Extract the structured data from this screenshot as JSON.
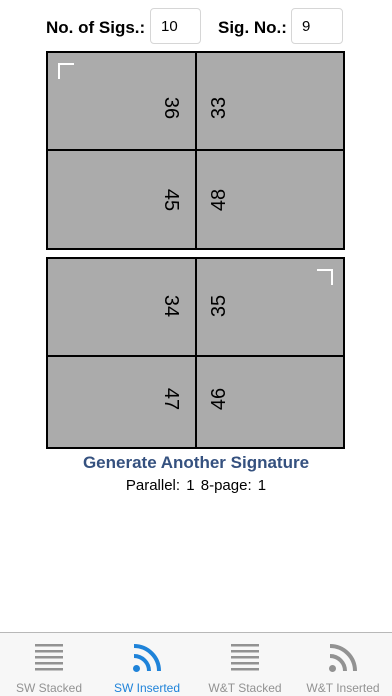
{
  "header": {
    "num_sigs_label": "No. of Sigs.:",
    "num_sigs_value": "10",
    "sig_no_label": "Sig. No.:",
    "sig_no_value": "9"
  },
  "sheets": [
    {
      "pages": {
        "top_left": "36",
        "top_right": "33",
        "bottom_left": "45",
        "bottom_right": "48"
      }
    },
    {
      "pages": {
        "top_left": "34",
        "top_right": "35",
        "bottom_left": "47",
        "bottom_right": "46"
      }
    }
  ],
  "generate_label": "Generate Another Signature",
  "info": {
    "parallel": "Parallel: 1",
    "eight_page": "8-page: 1"
  },
  "tabs": [
    {
      "label": "SW Stacked",
      "icon": "stack-lines-icon",
      "active": false
    },
    {
      "label": "SW Inserted",
      "icon": "broadcast-icon",
      "active": true
    },
    {
      "label": "W&T Stacked",
      "icon": "stack-lines-icon",
      "active": false
    },
    {
      "label": "W&T Inserted",
      "icon": "broadcast-icon",
      "active": false
    }
  ],
  "colors": {
    "sheet": "#ababab",
    "accent": "#1f83d9",
    "generate_text": "#35517f",
    "inactive_tab": "#929292"
  }
}
